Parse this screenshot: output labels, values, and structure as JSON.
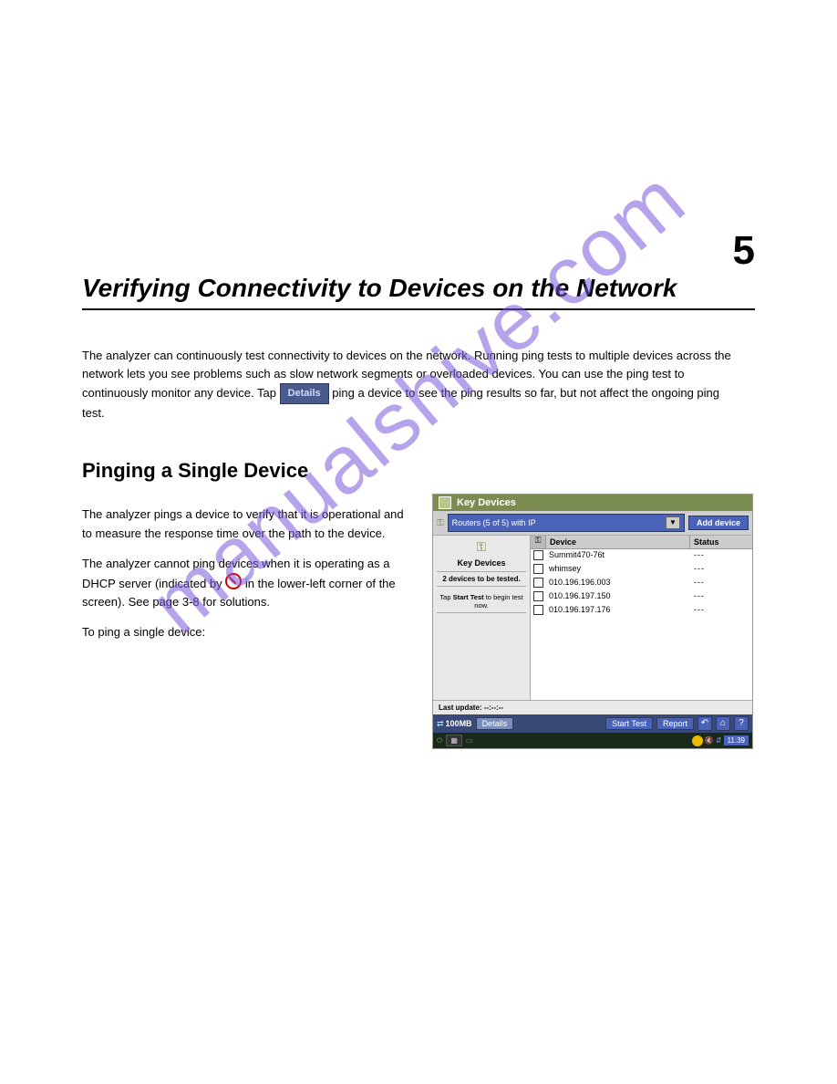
{
  "watermark": "manualshive.com",
  "chapter": {
    "title": "Verifying Connectivity to Devices on the Network",
    "number": "5"
  },
  "intro_p1_pre": "The analyzer can continuously test connectivity to devices on the network. Running ping tests to multiple devices across the network lets you see problems such as slow network segments or overloaded devices. You can use the ping test to continuously monitor any device. Tap ",
  "intro_p1_post": " ping a device to see the ping results so far, but not affect the ongoing ping test.",
  "section_title": "Pinging a Single Device",
  "left_col": {
    "p1": "The analyzer pings a device to verify that it is operational and to measure the response time over the path to the device.",
    "p2_pre": "The analyzer cannot ping devices when it is operating as a DHCP server (indicated by ",
    "p2_post": " in the lower-left corner of the screen). See page 3-8 for solutions.",
    "to_ping": "To ping a single device:"
  },
  "screenshot": {
    "title": "Key Devices",
    "dropdown": "Routers (5 of 5) with IP",
    "add_device": "Add device",
    "side_title": "Key Devices",
    "side_sub": "2 devices to be tested.",
    "side_tip_pre": "Tap ",
    "side_tip_bold": "Start Test",
    "side_tip_post": " to begin test now.",
    "col_device": "Device",
    "col_status": "Status",
    "rows": [
      {
        "name": "Summit470-76t",
        "status": "---"
      },
      {
        "name": "whimsey",
        "status": "---"
      },
      {
        "name": "010.196.196.003",
        "status": "---"
      },
      {
        "name": "010.196.197.150",
        "status": "---"
      },
      {
        "name": "010.196.197.176",
        "status": "---"
      }
    ],
    "last_update": "Last update: --:--:--",
    "link_100mb": "100MB",
    "btn_details": "Details",
    "btn_start": "Start Test",
    "btn_report": "Report",
    "time": "11:39"
  }
}
